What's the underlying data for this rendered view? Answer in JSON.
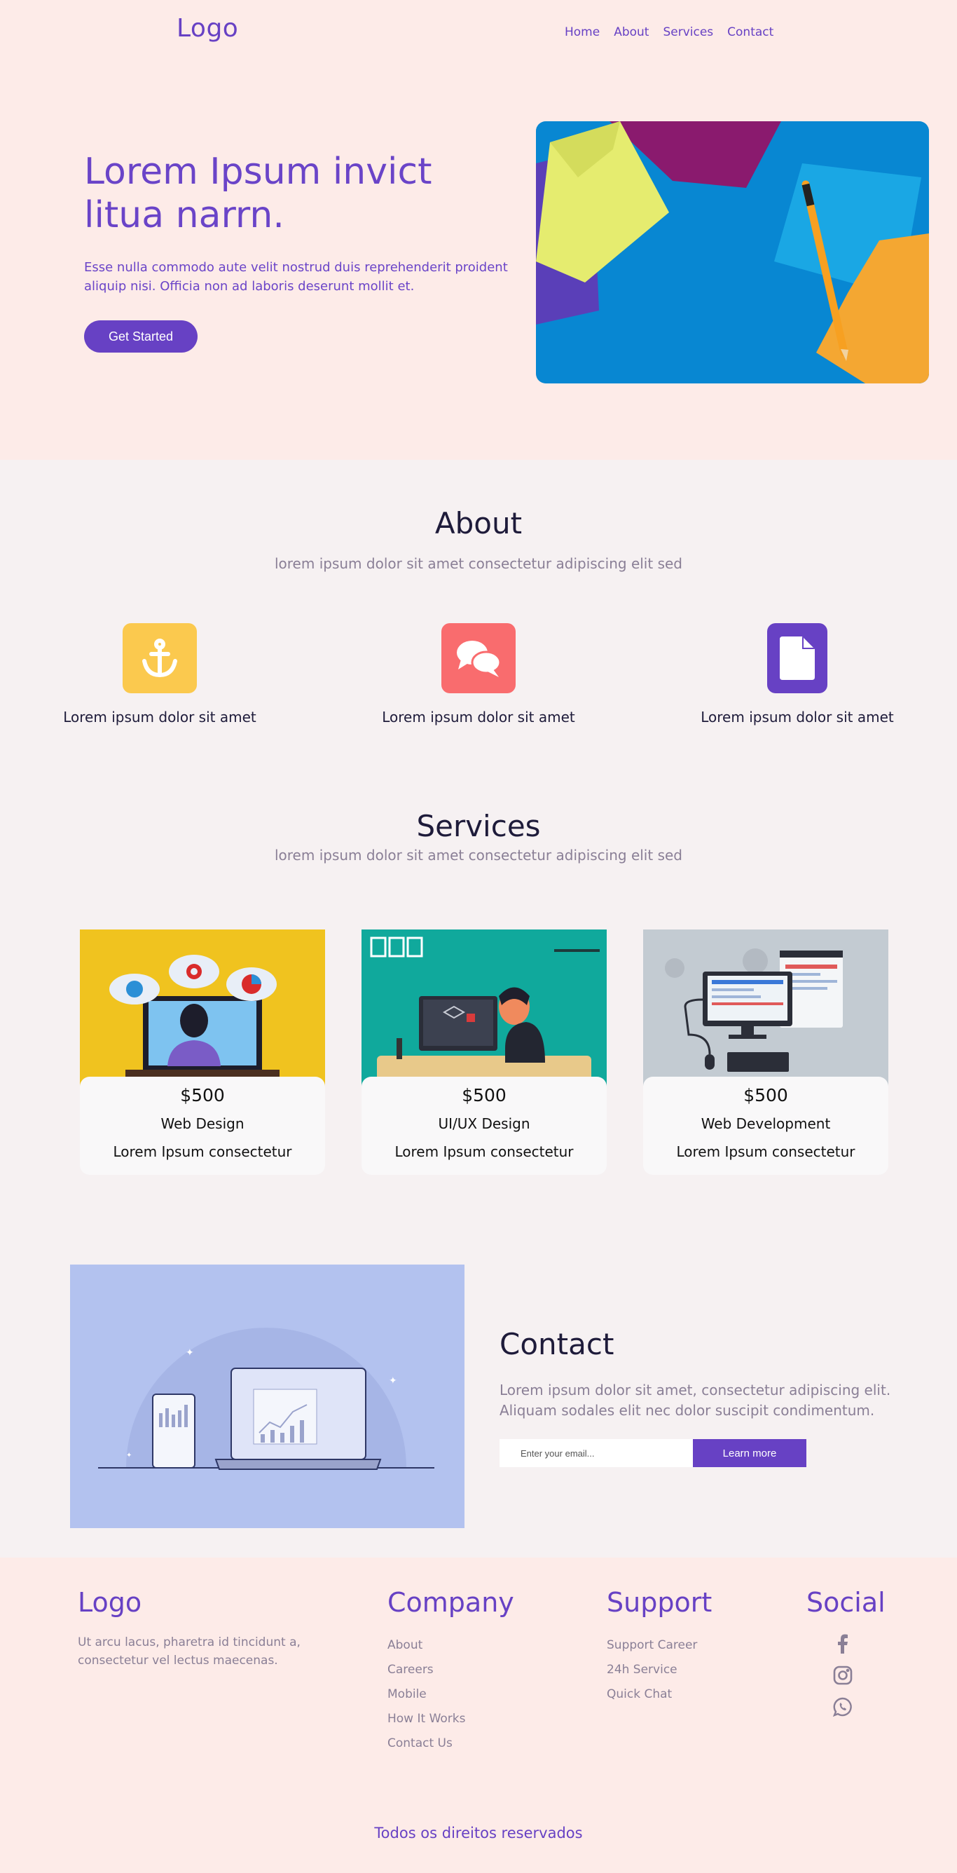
{
  "header": {
    "logo": "Logo",
    "nav": [
      "Home",
      "About",
      "Services",
      "Contact"
    ]
  },
  "hero": {
    "title": "Lorem Ipsum invict litua narrn.",
    "text": "Esse nulla commodo aute velit nostrud duis reprehenderit proident aliquip nisi. Officia non ad laboris deserunt mollit et.",
    "button": "Get Started"
  },
  "about": {
    "title": "About",
    "subtitle": "lorem ipsum dolor sit amet consectetur adipiscing elit sed",
    "features": [
      {
        "icon": "anchor-icon",
        "color": "#fbc94e",
        "label": "Lorem ipsum dolor sit amet"
      },
      {
        "icon": "chat-bubbles-icon",
        "color": "#f96c6e",
        "label": "Lorem ipsum dolor sit amet"
      },
      {
        "icon": "document-icon",
        "color": "#6741c4",
        "label": "Lorem ipsum dolor sit amet"
      }
    ]
  },
  "services": {
    "title": "Services",
    "subtitle": "lorem ipsum dolor sit amet consectetur adipiscing elit sed",
    "cards": [
      {
        "price": "$500",
        "name": "Web Design",
        "desc": "Lorem Ipsum consectetur"
      },
      {
        "price": "$500",
        "name": "UI/UX Design",
        "desc": "Lorem Ipsum consectetur"
      },
      {
        "price": "$500",
        "name": "Web Development",
        "desc": "Lorem Ipsum consectetur"
      }
    ]
  },
  "contact": {
    "title": "Contact",
    "text": "Lorem ipsum dolor sit amet, consectetur adipiscing elit. Aliquam sodales elit nec dolor suscipit condimentum.",
    "email_placeholder": "Enter your email...",
    "button": "Learn more"
  },
  "footer": {
    "logo": "Logo",
    "text": "Ut arcu lacus, pharetra id tincidunt a, consectetur vel lectus maecenas.",
    "company": {
      "title": "Company",
      "links": [
        "About",
        "Careers",
        "Mobile",
        "How It Works",
        "Contact Us"
      ]
    },
    "support": {
      "title": "Support",
      "links": [
        "Support Career",
        "24h Service",
        "Quick Chat"
      ]
    },
    "social": {
      "title": "Social",
      "icons": [
        "facebook-icon",
        "instagram-icon",
        "whatsapp-icon"
      ]
    },
    "copyright": "Todos os direitos reservados"
  },
  "colors": {
    "accent": "#6741c4",
    "hero_bg": "#fdebe8",
    "page_bg": "#f6f1f2",
    "muted_text": "#8a7f96"
  }
}
